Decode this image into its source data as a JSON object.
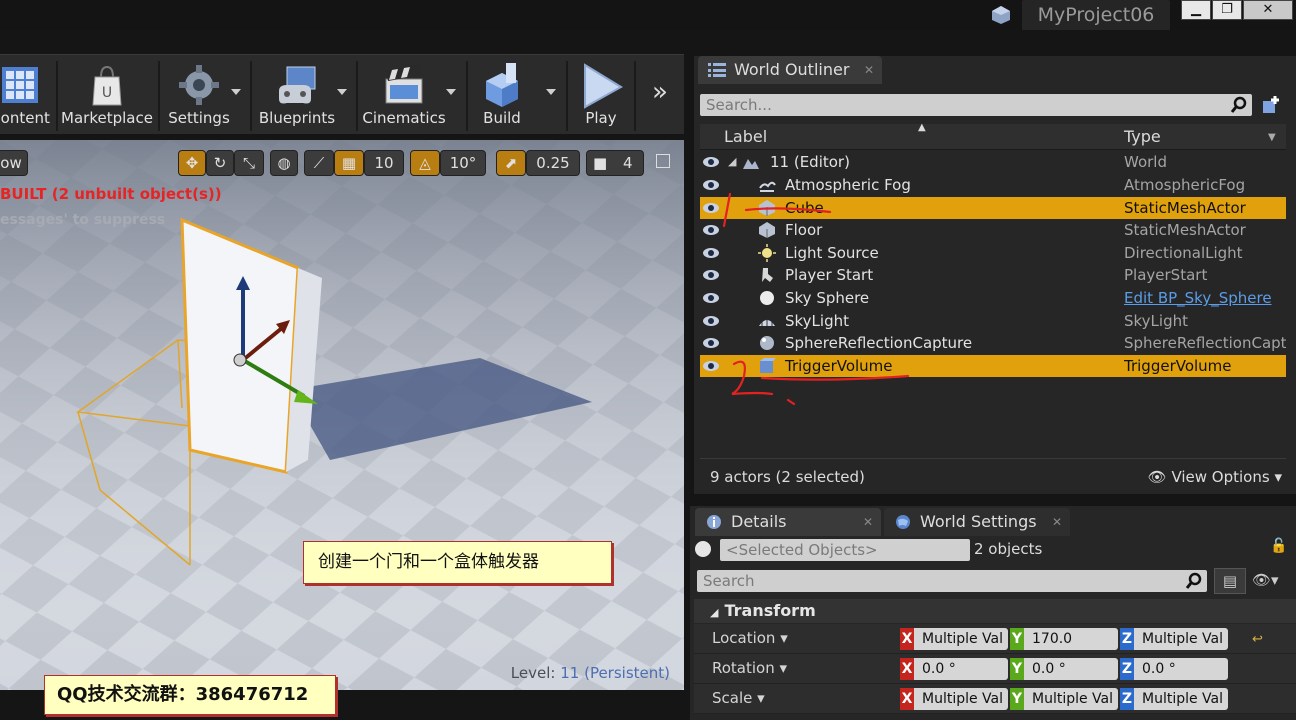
{
  "window": {
    "project_tab": "MyProject06",
    "minimize": "▁",
    "maximize": "❐",
    "close": "✕"
  },
  "toolbar": {
    "items": [
      {
        "label": "Content",
        "icon": "content-icon"
      },
      {
        "label": "Marketplace",
        "icon": "marketplace-icon"
      },
      {
        "label": "Settings",
        "icon": "settings-icon"
      },
      {
        "label": "Blueprints",
        "icon": "blueprints-icon"
      },
      {
        "label": "Cinematics",
        "icon": "cinematics-icon"
      },
      {
        "label": "Build",
        "icon": "build-icon"
      },
      {
        "label": "Play",
        "icon": "play-icon"
      }
    ],
    "more": "»"
  },
  "viewport": {
    "left_button": "ow",
    "snap_grid": "10",
    "snap_rotation": "10°",
    "snap_scale": "0.25",
    "camera_speed": "4",
    "warning": "BUILT (2 unbuilt object(s))",
    "hint": "essages' to suppress",
    "level_label": "Level:",
    "level_value": "11 (Persistent)",
    "note": "创建一个门和一个盒体触发器",
    "qq": "QQ技术交流群：386476712"
  },
  "outliner": {
    "tab": "World Outliner",
    "search_placeholder": "Search...",
    "col_label": "Label",
    "col_type": "Type",
    "root": {
      "name": "11 (Editor)",
      "type": "World"
    },
    "rows": [
      {
        "name": "Atmospheric Fog",
        "type": "AtmosphericFog",
        "icon": "fog-icon",
        "selected": false
      },
      {
        "name": "Cube",
        "type": "StaticMeshActor",
        "icon": "static-mesh-icon",
        "selected": true
      },
      {
        "name": "Floor",
        "type": "StaticMeshActor",
        "icon": "static-mesh-icon",
        "selected": false
      },
      {
        "name": "Light Source",
        "type": "DirectionalLight",
        "icon": "light-icon",
        "selected": false
      },
      {
        "name": "Player Start",
        "type": "PlayerStart",
        "icon": "player-start-icon",
        "selected": false
      },
      {
        "name": "Sky Sphere",
        "type": "Edit BP_Sky_Sphere",
        "icon": "sphere-icon",
        "selected": false
      },
      {
        "name": "SkyLight",
        "type": "SkyLight",
        "icon": "skylight-icon",
        "selected": false
      },
      {
        "name": "SphereReflectionCapture",
        "type": "SphereReflectionCaptur",
        "icon": "reflection-icon",
        "selected": false
      },
      {
        "name": "TriggerVolume",
        "type": "TriggerVolume",
        "icon": "trigger-volume-icon",
        "selected": true
      }
    ],
    "footer_count": "9 actors (2 selected)",
    "view_options": "View Options"
  },
  "details": {
    "tab_details": "Details",
    "tab_world_settings": "World Settings",
    "selected_objects_placeholder": "<Selected Objects>",
    "objects_count": "2 objects",
    "search_placeholder": "Search",
    "section": "Transform",
    "properties": [
      {
        "name": "Location",
        "x": "Multiple Val",
        "y": "170.0",
        "z": "Multiple Val"
      },
      {
        "name": "Rotation",
        "x": "0.0 °",
        "y": "0.0 °",
        "z": "0.0 °"
      },
      {
        "name": "Scale",
        "x": "Multiple Val",
        "y": "Multiple Val",
        "z": "Multiple Val"
      }
    ],
    "axis_labels": {
      "x": "X",
      "y": "Y",
      "z": "Z"
    }
  },
  "colors": {
    "selection": "#e1a10c",
    "accent_link": "#5b9de8",
    "warning": "#e62424"
  }
}
